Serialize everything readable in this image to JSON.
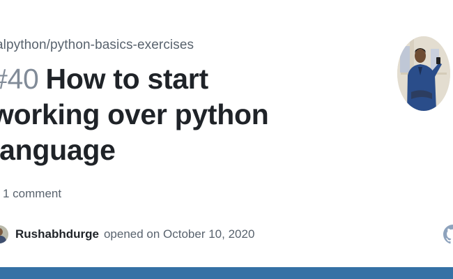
{
  "repo": {
    "path": "alpython/python-basics-exercises"
  },
  "issue": {
    "number": "#40",
    "title": "How to start working over python language",
    "comments": "1 comment",
    "author": "Rushabhdurge",
    "opened": "opened on October 10, 2020"
  },
  "icons": {
    "comment": "comment-icon",
    "github": "github-mark-icon",
    "avatar": "avatar-icon"
  },
  "colors": {
    "title": "#1f2328",
    "muted": "#59636e",
    "number": "#818b98",
    "bottom_bar": "#3571a5"
  }
}
